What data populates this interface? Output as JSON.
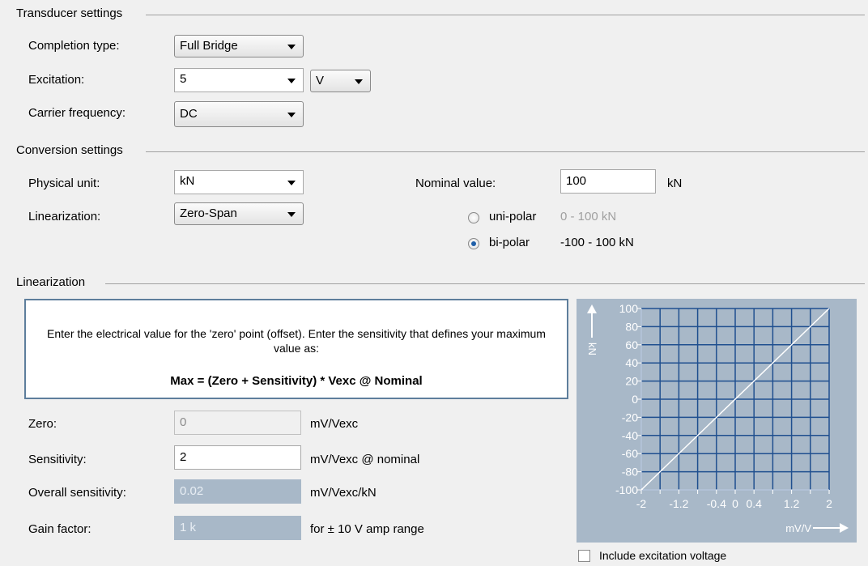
{
  "transducer": {
    "title": "Transducer settings",
    "completion_label": "Completion type:",
    "completion_value": "Full Bridge",
    "excitation_label": "Excitation:",
    "excitation_value": "5",
    "excitation_unit": "V",
    "carrier_label": "Carrier frequency:",
    "carrier_value": "DC"
  },
  "conversion": {
    "title": "Conversion settings",
    "physical_unit_label": "Physical unit:",
    "physical_unit_value": "kN",
    "linearization_label": "Linearization:",
    "linearization_value": "Zero-Span",
    "nominal_label": "Nominal value:",
    "nominal_value": "100",
    "nominal_unit": "kN",
    "unipolar_label": "uni-polar",
    "unipolar_range": "0 - 100 kN",
    "bipolar_label": "bi-polar",
    "bipolar_range": "-100 - 100 kN",
    "selected_polarity": "bi-polar"
  },
  "linearization": {
    "title": "Linearization",
    "info_text": "Enter the electrical value for the 'zero' point (offset). Enter the sensitivity that defines your maximum value as:",
    "formula": "Max = (Zero + Sensitivity) * Vexc @ Nominal",
    "zero_label": "Zero:",
    "zero_value": "0",
    "zero_unit": "mV/Vexc",
    "sensitivity_label": "Sensitivity:",
    "sensitivity_value": "2",
    "sensitivity_unit": "mV/Vexc @ nominal",
    "overall_label": "Overall sensitivity:",
    "overall_value": "0.02",
    "overall_unit": "mV/Vexc/kN",
    "gain_label": "Gain factor:",
    "gain_value": "1 k",
    "gain_unit": "for ± 10 V amp range",
    "include_excitation_label": "Include excitation voltage",
    "include_excitation_checked": false
  },
  "chart_data": {
    "type": "line",
    "xlabel": "mV/V",
    "ylabel": "kN",
    "xlim": [
      -2,
      2
    ],
    "ylim": [
      -100,
      100
    ],
    "x_ticks": [
      "-2",
      "-1.2",
      "-0.4",
      "0",
      "0.4",
      "1.2",
      "2"
    ],
    "x_tick_values": [
      -2,
      -1.2,
      -0.4,
      0,
      0.4,
      1.2,
      2
    ],
    "y_ticks": [
      "100",
      "80",
      "60",
      "40",
      "20",
      "0",
      "-20",
      "-40",
      "-60",
      "-80",
      "-100"
    ],
    "y_tick_values": [
      100,
      80,
      60,
      40,
      20,
      0,
      -20,
      -40,
      -60,
      -80,
      -100
    ],
    "grid": true,
    "series": [
      {
        "x": [
          -2,
          2
        ],
        "y": [
          -100,
          100
        ]
      }
    ],
    "colors": {
      "background": "#a8b8c8",
      "grid": "#1f4f8f",
      "line": "#ffffff",
      "text": "#ffffff"
    }
  }
}
